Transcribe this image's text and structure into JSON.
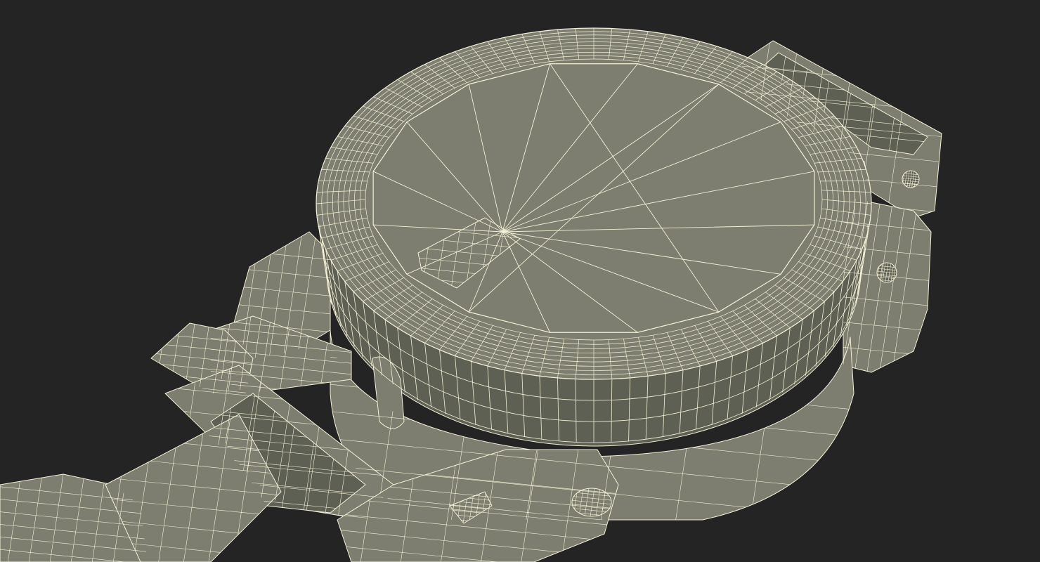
{
  "viewport": {
    "background_color": "#242424",
    "surface_color": "#7d7e6f",
    "surface_shadow_color": "#5f6054",
    "surface_highlight_color": "#8b8c7c",
    "wireframe_color": "#f4f1d8"
  },
  "model": {
    "subject": "compass-wireframe-model",
    "parts": [
      "lid",
      "knurled-bezel",
      "base-ring",
      "sighting-bracket",
      "hinge-arm",
      "front-frame"
    ],
    "bezel_tooth_count": 96,
    "bezel_ring_count": 9
  }
}
